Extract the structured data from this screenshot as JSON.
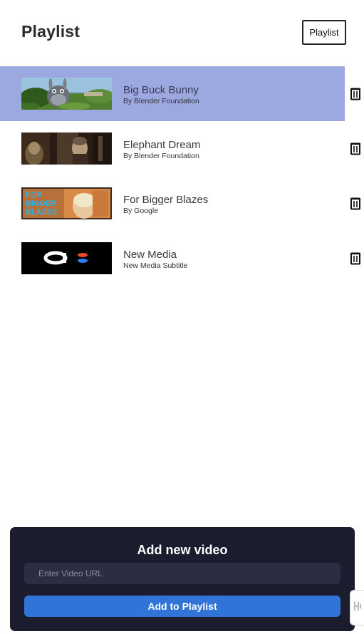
{
  "header": {
    "title": "Playlist",
    "button_label": "Playlist"
  },
  "playlist": {
    "items": [
      {
        "title": "Big Buck Bunny",
        "subtitle": "By Blender Foundation",
        "active": true
      },
      {
        "title": "Elephant Dream",
        "subtitle": "By Blender Foundation",
        "active": false
      },
      {
        "title": "For Bigger Blazes",
        "subtitle": "By Google",
        "active": false
      },
      {
        "title": "New Media",
        "subtitle": "New Media Subtitle",
        "active": false
      }
    ],
    "thumbnail_text_blazes": "FOR BIGGER BLAZES"
  },
  "add_video": {
    "title": "Add new video",
    "input_placeholder": "Enter Video URL",
    "input_value": "",
    "button_label": "Add to Playlist"
  },
  "colors": {
    "active_row": "#9ba9e0",
    "panel_bg": "#1b1c2e",
    "input_bg": "#2c2d42",
    "button_bg": "#2f74d6"
  },
  "icons": {
    "delete": "trash-icon",
    "side_tab": "handwave-icon"
  }
}
